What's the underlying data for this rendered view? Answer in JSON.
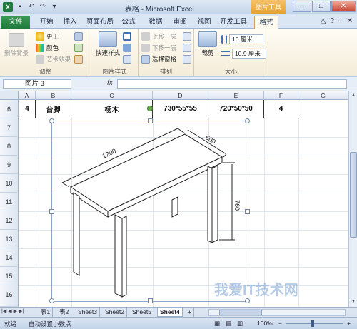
{
  "window": {
    "title": "表格 - Microsoft Excel",
    "context_tab_title": "图片工具",
    "controls": [
      "–",
      "□",
      "✕"
    ]
  },
  "ribbon_tabs": [
    {
      "label": "文件"
    },
    {
      "label": "开始"
    },
    {
      "label": "插入"
    },
    {
      "label": "页面布局"
    },
    {
      "label": "公式"
    },
    {
      "label": "数据"
    },
    {
      "label": "审阅"
    },
    {
      "label": "视图"
    },
    {
      "label": "开发工具"
    },
    {
      "label": "格式"
    }
  ],
  "ribbon": {
    "adjust": {
      "remove_background": "删除背景",
      "corrections": "更正",
      "color": "颜色",
      "artistic_effects": "艺术效果",
      "group_label": "调整"
    },
    "picture_styles": {
      "quick_styles": "快速样式",
      "group_label": "图片样式"
    },
    "arrange": {
      "bring_forward": "上移一层",
      "send_backward": "下移一层",
      "selection_pane": "选择窗格",
      "group_label": "排列"
    },
    "size": {
      "crop": "裁剪",
      "height": "10 厘米",
      "width": "10.9 厘米",
      "group_label": "大小"
    }
  },
  "formula_bar": {
    "name_box": "图片 3",
    "fx": "fx",
    "value": ""
  },
  "grid": {
    "columns": [
      "A",
      "B",
      "C",
      "D",
      "E",
      "F",
      "G"
    ],
    "rows": [
      "6",
      "7",
      "8",
      "9",
      "10",
      "11",
      "12",
      "13",
      "14",
      "15",
      "16"
    ],
    "row6": [
      "4",
      "台脚",
      "杨木",
      "730*55*55",
      "720*50*50",
      "4"
    ]
  },
  "drawing": {
    "dimension_length": "1200",
    "dimension_depth": "600",
    "dimension_height": "760"
  },
  "sheet_tabs": [
    "表1",
    "表2",
    "Sheet3",
    "Sheet2",
    "Sheet5",
    "Sheet4"
  ],
  "status": {
    "ready": "就绪",
    "auto_decimal": "自动设置小数点",
    "zoom": "100%"
  },
  "watermark": "我爱IT技术网"
}
